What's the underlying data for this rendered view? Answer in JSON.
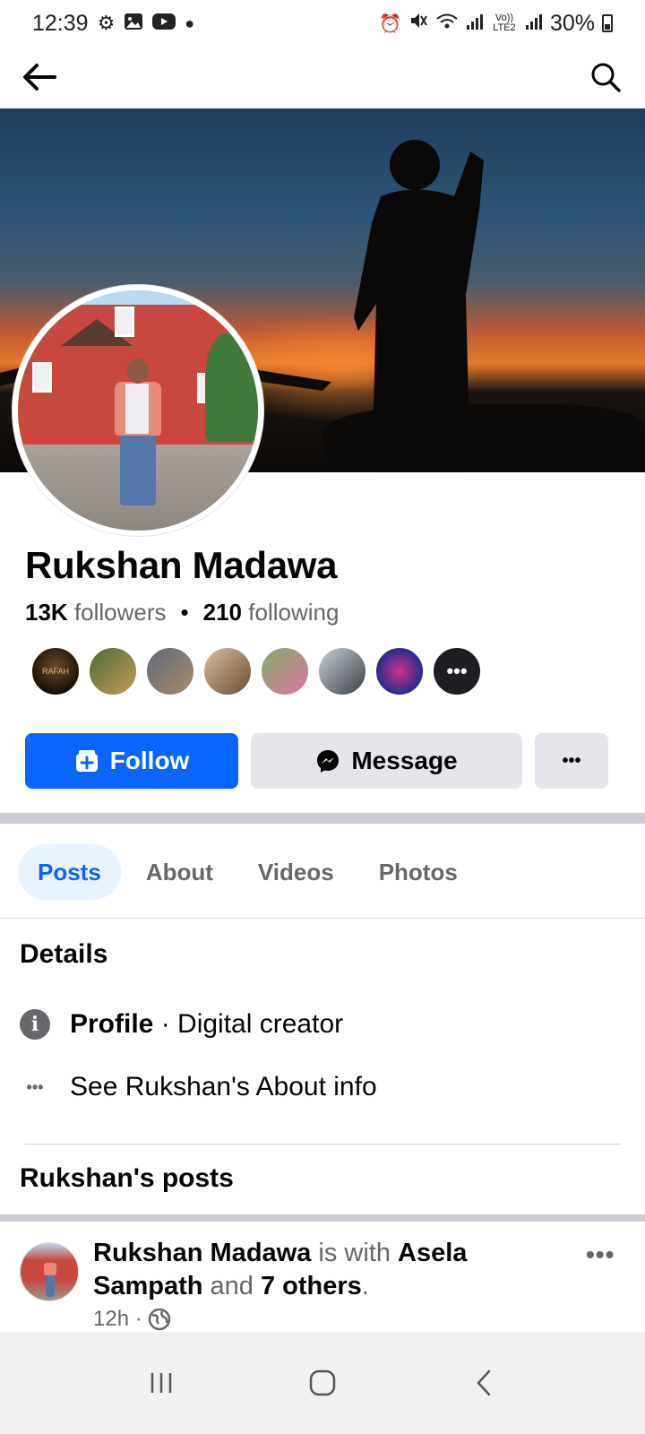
{
  "status_bar": {
    "time": "12:39",
    "battery": "30%",
    "left_icons": [
      "gear-icon",
      "gallery-icon",
      "youtube-icon",
      "dot-icon"
    ],
    "right_icons": [
      "alarm-icon",
      "mute-icon",
      "wifi-icon",
      "signal-icon",
      "volte-icon",
      "signal-icon",
      "battery-icon"
    ],
    "volte_label": "Vo)) LTE2"
  },
  "top_nav": {
    "back_icon": "back-arrow-icon",
    "search_icon": "search-icon"
  },
  "profile": {
    "name": "Rukshan Madawa",
    "followers_count": "13K",
    "followers_label": "followers",
    "following_count": "210",
    "following_label": "following",
    "mutual_more": "•••"
  },
  "actions": {
    "follow_label": "Follow",
    "message_label": "Message",
    "more_label": "•••"
  },
  "tabs": [
    {
      "label": "Posts",
      "active": true
    },
    {
      "label": "About",
      "active": false
    },
    {
      "label": "Videos",
      "active": false
    },
    {
      "label": "Photos",
      "active": false
    }
  ],
  "details": {
    "title": "Details",
    "profile_label": "Profile",
    "profile_separator": "·",
    "profile_category": "Digital creator",
    "about_link": "See Rukshan's About info"
  },
  "posts": {
    "title": "Rukshan's posts",
    "first_post": {
      "author": "Rukshan Madawa",
      "is_with": "is with",
      "tagged": "Asela Sampath",
      "and": "and",
      "others": "7 others",
      "end": ".",
      "time": "12h ·",
      "privacy_icon": "globe-icon",
      "more": "•••"
    }
  },
  "colors": {
    "accent": "#0866ff",
    "secondary_button": "#e4e6eb",
    "active_tab_bg": "#e7f3ff",
    "muted_text": "#65676b"
  }
}
